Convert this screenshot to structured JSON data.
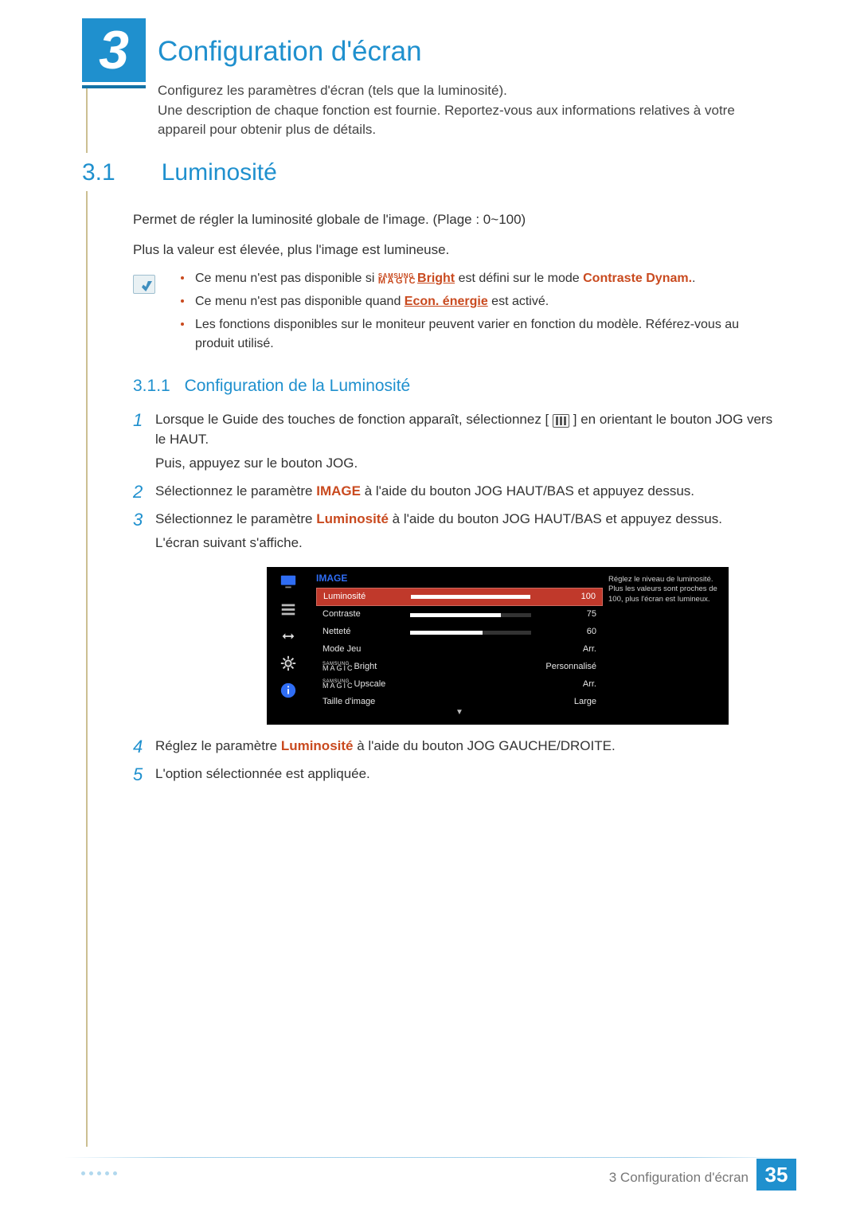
{
  "chapter": {
    "number": "3",
    "title": "Configuration d'écran",
    "intro1": "Configurez les paramètres d'écran (tels que la luminosité).",
    "intro2": "Une description de chaque fonction est fournie. Reportez-vous aux informations relatives à votre appareil pour obtenir plus de détails."
  },
  "section": {
    "num": "3.1",
    "title": "Luminosité",
    "p1": "Permet de régler la luminosité globale de l'image. (Plage : 0~100)",
    "p2": "Plus la valeur est élevée, plus l'image est lumineuse."
  },
  "notes": {
    "n1_a": "Ce menu n'est pas disponible si ",
    "n1_magic_top": "SAMSUNG",
    "n1_magic_bot": "MAGIC",
    "n1_bright": "Bright",
    "n1_b": " est défini sur le mode ",
    "n1_mode": "Contraste Dynam.",
    "n1_end": ".",
    "n2_a": "Ce menu n'est pas disponible quand ",
    "n2_link": "Econ. énergie",
    "n2_b": " est activé.",
    "n3": "Les fonctions disponibles sur le moniteur peuvent varier en fonction du modèle. Référez-vous au produit utilisé."
  },
  "subsection": {
    "num": "3.1.1",
    "title": "Configuration de la Luminosité"
  },
  "steps": {
    "s1_a": "Lorsque le Guide des touches de fonction apparaît, sélectionnez [",
    "s1_b": "] en orientant le bouton JOG vers le HAUT.",
    "s1_c": "Puis, appuyez sur le bouton JOG.",
    "s2_a": "Sélectionnez le paramètre ",
    "s2_hl": "IMAGE",
    "s2_b": " à l'aide du bouton JOG HAUT/BAS et appuyez dessus.",
    "s3_a": "Sélectionnez le paramètre ",
    "s3_hl": "Luminosité",
    "s3_b": " à l'aide du bouton JOG HAUT/BAS et appuyez dessus.",
    "s3_c": "L'écran suivant s'affiche.",
    "s4_a": "Réglez le paramètre ",
    "s4_hl": "Luminosité",
    "s4_b": " à l'aide du bouton JOG GAUCHE/DROITE.",
    "s5": "L'option sélectionnée est appliquée."
  },
  "osd": {
    "title": "IMAGE",
    "help": "Réglez le niveau de luminosité. Plus les valeurs sont proches de 100, plus l'écran est lumineux.",
    "rows": [
      {
        "label": "Luminosité",
        "type": "bar",
        "value": 100,
        "display": "100",
        "selected": true
      },
      {
        "label": "Contraste",
        "type": "bar",
        "value": 75,
        "display": "75"
      },
      {
        "label": "Netteté",
        "type": "bar",
        "value": 60,
        "display": "60"
      },
      {
        "label": "Mode Jeu",
        "type": "text",
        "display": "Arr."
      },
      {
        "label": "MAGICBright",
        "type": "magic",
        "suffix": "Bright",
        "display": "Personnalisé"
      },
      {
        "label": "MAGICUpscale",
        "type": "magic",
        "suffix": "Upscale",
        "display": "Arr."
      },
      {
        "label": "Taille d'image",
        "type": "text",
        "display": "Large"
      }
    ],
    "magic_top": "SAMSUNG",
    "magic_bot": "MAGIC"
  },
  "footer": {
    "label": "3 Configuration d'écran",
    "page": "35"
  }
}
